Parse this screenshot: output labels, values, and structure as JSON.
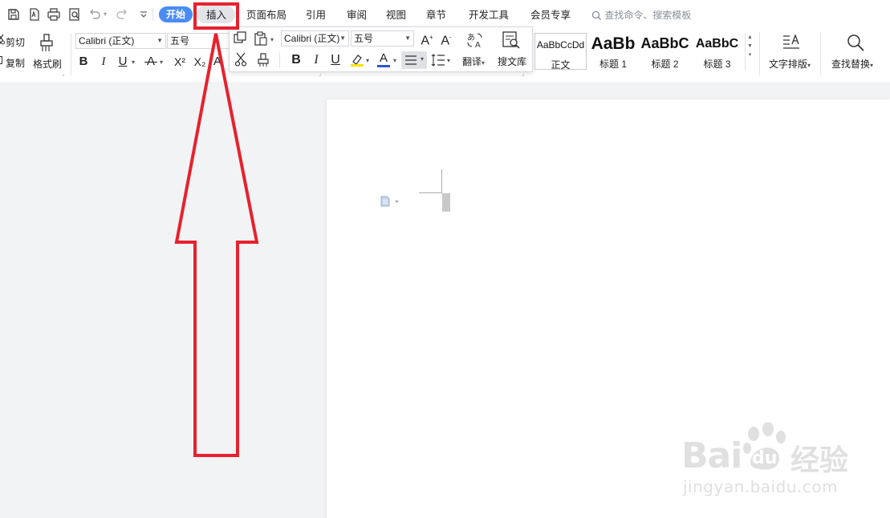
{
  "quick_access": {
    "icons": [
      "save-icon",
      "export-pdf-icon",
      "print-icon",
      "print-preview-icon",
      "undo-icon",
      "redo-icon",
      "customize-icon"
    ]
  },
  "tabs": {
    "start": "开始",
    "insert": "插入",
    "page_layout": "页面布局",
    "references": "引用",
    "review": "审阅",
    "view": "视图",
    "chapter": "章节",
    "developer": "开发工具",
    "member": "会员专享",
    "search_placeholder": "查找命令、搜索模板"
  },
  "clipboard": {
    "cut": "剪切",
    "copy": "复制",
    "format_painter": "格式刷"
  },
  "font": {
    "name": "Calibri (正文)",
    "size": "五号",
    "mini_name": "Calibri (正文)",
    "mini_size": "五号",
    "bold": "B",
    "italic": "I",
    "underline": "U",
    "superscript": "X²",
    "subscript": "X₂"
  },
  "mini_toolbar": {
    "translate": "翻译",
    "search_library": "搜文库"
  },
  "styles": [
    {
      "sample": "AaBbCcDd",
      "name": "正文"
    },
    {
      "sample": "AaBb",
      "name": "标题 1"
    },
    {
      "sample": "AaBbC",
      "name": "标题 2"
    },
    {
      "sample": "AaBbC",
      "name": "标题 3"
    }
  ],
  "right_ribbon": {
    "text_layout": "文字排版",
    "find_replace": "查找替换"
  },
  "watermark": {
    "brand": "Bai",
    "brand_du": "du",
    "brand_cn": "经验",
    "url": "jingyan.baidu.com"
  },
  "colors": {
    "accent": "#4a8cf6",
    "annotation": "#e5222e",
    "highlight": "#f7e400",
    "font_color": "#2b57d9"
  }
}
